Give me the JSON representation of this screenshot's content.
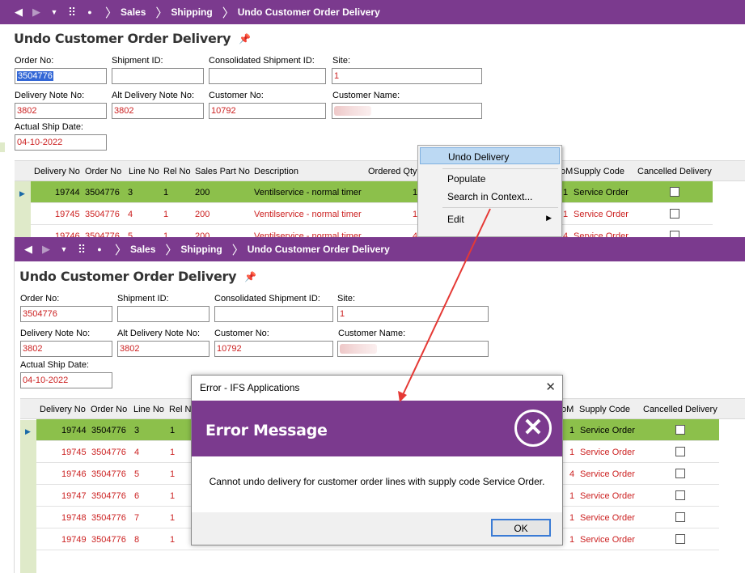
{
  "nav": {
    "crumbs": [
      "Sales",
      "Shipping",
      "Undo Customer Order Delivery"
    ]
  },
  "page": {
    "title": "Undo Customer Order Delivery"
  },
  "form": {
    "order_no_label": "Order No:",
    "order_no": "3504776",
    "shipment_id_label": "Shipment ID:",
    "shipment_id": "",
    "consolidated_label": "Consolidated Shipment ID:",
    "consolidated": "",
    "site_label": "Site:",
    "site": "1",
    "delivery_note_label": "Delivery Note No:",
    "delivery_note": "3802",
    "alt_delivery_note_label": "Alt Delivery Note No:",
    "alt_delivery_note": "3802",
    "customer_no_label": "Customer No:",
    "customer_no": "10792",
    "customer_name_label": "Customer Name:",
    "actual_ship_date_label": "Actual Ship Date:",
    "actual_ship_date": "04-10-2022"
  },
  "grid": {
    "headers": {
      "delivery_no": "Delivery No",
      "order_no": "Order No",
      "line_no": "Line No",
      "rel_no": "Rel No",
      "sales_part_no": "Sales Part No",
      "description": "Description",
      "ordered_qty": "Ordered Qty",
      "uom_tail": "oM",
      "supply_code": "Supply Code",
      "cancelled_delivery": "Cancelled Delivery"
    },
    "top_rows": [
      {
        "delivery_no": "19744",
        "order_no": "3504776",
        "line_no": "3",
        "rel_no": "1",
        "sales_part_no": "200",
        "description": "Ventilservice - normal timer",
        "ordered_qty": "1",
        "uom": "1",
        "supply_code": "Service Order"
      },
      {
        "delivery_no": "19745",
        "order_no": "3504776",
        "line_no": "4",
        "rel_no": "1",
        "sales_part_no": "200",
        "description": "Ventilservice - normal timer",
        "ordered_qty": "1",
        "uom": "1",
        "supply_code": "Service Order"
      },
      {
        "delivery_no": "19746",
        "order_no": "3504776",
        "line_no": "5",
        "rel_no": "1",
        "sales_part_no": "200",
        "description": "Ventilservice - normal timer",
        "ordered_qty": "4",
        "uom": "4",
        "supply_code": "Service Order"
      }
    ],
    "bottom_rows": [
      {
        "delivery_no": "19744",
        "order_no": "3504776",
        "line_no": "3",
        "rel_no": "1",
        "uom": "1",
        "supply_code": "Service Order"
      },
      {
        "delivery_no": "19745",
        "order_no": "3504776",
        "line_no": "4",
        "rel_no": "1",
        "uom": "1",
        "supply_code": "Service Order"
      },
      {
        "delivery_no": "19746",
        "order_no": "3504776",
        "line_no": "5",
        "rel_no": "1",
        "uom": "4",
        "supply_code": "Service Order"
      },
      {
        "delivery_no": "19747",
        "order_no": "3504776",
        "line_no": "6",
        "rel_no": "1",
        "uom": "1",
        "supply_code": "Service Order"
      },
      {
        "delivery_no": "19748",
        "order_no": "3504776",
        "line_no": "7",
        "rel_no": "1",
        "uom": "1",
        "supply_code": "Service Order"
      },
      {
        "delivery_no": "19749",
        "order_no": "3504776",
        "line_no": "8",
        "rel_no": "1",
        "uom": "1",
        "supply_code": "Service Order"
      }
    ]
  },
  "context_menu": {
    "undo_delivery": "Undo Delivery",
    "populate": "Populate",
    "search_in_context": "Search in Context...",
    "edit": "Edit"
  },
  "dialog": {
    "window_title": "Error - IFS Applications",
    "heading": "Error Message",
    "message": "Cannot undo delivery for customer order lines with supply code Service Order.",
    "ok_label": "OK"
  },
  "colors": {
    "brand_purple": "#7b3a8e",
    "active_row_green": "#8cc04b",
    "value_red": "#cc2222",
    "annotation_arrow": "#e53935"
  }
}
